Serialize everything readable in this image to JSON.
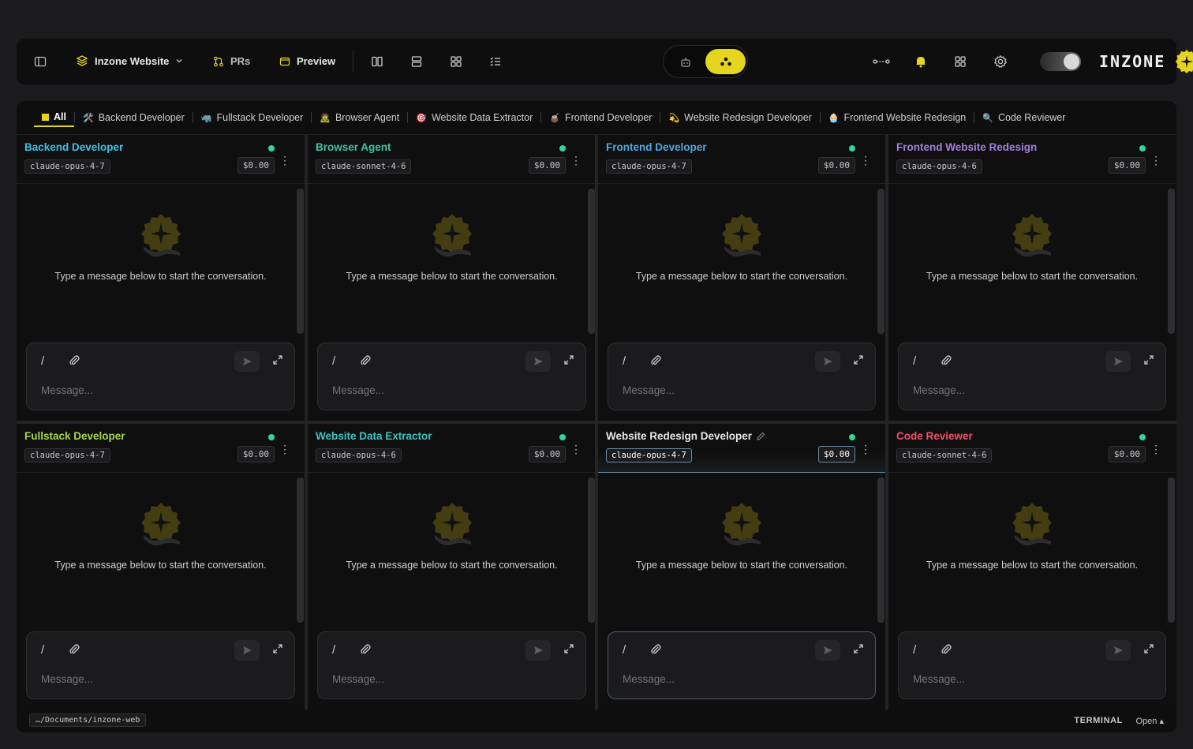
{
  "toolbar": {
    "project_name": "Inzone Website",
    "prs_label": "PRs",
    "preview_label": "Preview",
    "brand_name": "INZONE"
  },
  "colors": {
    "accent": "#e6d51e",
    "status_dot": "#2fd89a",
    "background": "#1b1b1d",
    "panel": "#0f0f10"
  },
  "tabs": [
    {
      "label": "All",
      "icon": "yellow-square",
      "active": true
    },
    {
      "label": "Backend Developer",
      "icon": "🛠️"
    },
    {
      "label": "Fullstack Developer",
      "icon": "🦏"
    },
    {
      "label": "Browser Agent",
      "icon": "🧟"
    },
    {
      "label": "Website Data Extractor",
      "icon": "🎯"
    },
    {
      "label": "Frontend Developer",
      "icon": "🧉"
    },
    {
      "label": "Website Redesign Developer",
      "icon": "💫"
    },
    {
      "label": "Frontend Website Redesign",
      "icon": "🧁"
    },
    {
      "label": "Code Reviewer",
      "icon": "🔍"
    }
  ],
  "panels": [
    {
      "name": "Backend Developer",
      "name_color": "#3fc4e6",
      "model": "claude-opus-4-7",
      "cost": "$0.00",
      "empty_message": "Type a message below to start the conversation.",
      "placeholder": "Message..."
    },
    {
      "name": "Browser Agent",
      "name_color": "#3fc4a6",
      "model": "claude-sonnet-4-6",
      "cost": "$0.00",
      "empty_message": "Type a message below to start the conversation.",
      "placeholder": "Message..."
    },
    {
      "name": "Frontend Developer",
      "name_color": "#4ea9e8",
      "model": "claude-opus-4-7",
      "cost": "$0.00",
      "empty_message": "Type a message below to start the conversation.",
      "placeholder": "Message..."
    },
    {
      "name": "Frontend Website Redesign",
      "name_color": "#a77fe0",
      "model": "claude-opus-4-6",
      "cost": "$0.00",
      "empty_message": "Type a message below to start the conversation.",
      "placeholder": "Message..."
    },
    {
      "name": "Fullstack Developer",
      "name_color": "#a8d84a",
      "model": "claude-opus-4-7",
      "cost": "$0.00",
      "empty_message": "Type a message below to start the conversation.",
      "placeholder": "Message..."
    },
    {
      "name": "Website Data Extractor",
      "name_color": "#3fc4c0",
      "model": "claude-opus-4-6",
      "cost": "$0.00",
      "empty_message": "Type a message below to start the conversation.",
      "placeholder": "Message..."
    },
    {
      "name": "Website Redesign Developer",
      "name_color": "#e6e6e6",
      "model": "claude-opus-4-7",
      "cost": "$0.00",
      "empty_message": "Type a message below to start the conversation.",
      "placeholder": "Message...",
      "focused": true
    },
    {
      "name": "Code Reviewer",
      "name_color": "#f0506a",
      "model": "claude-sonnet-4-6",
      "cost": "$0.00",
      "empty_message": "Type a message below to start the conversation.",
      "placeholder": "Message..."
    }
  ],
  "statusbar": {
    "path": "…/Documents/inzone-web",
    "terminal_label": "TERMINAL",
    "open_label": "Open ▴"
  }
}
